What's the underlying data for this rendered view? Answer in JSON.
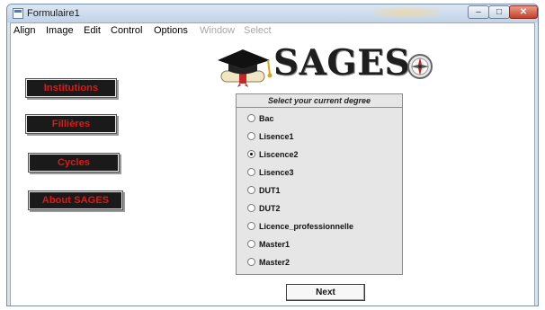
{
  "window": {
    "title": "Formulaire1",
    "controls": {
      "minimize_icon": "minimize-icon",
      "maximize_icon": "maximize-icon",
      "close_icon": "close-icon"
    }
  },
  "menu": [
    {
      "label": "Align",
      "enabled": true
    },
    {
      "label": "Image",
      "enabled": true
    },
    {
      "label": "Edit",
      "enabled": true
    },
    {
      "label": "Control",
      "enabled": true
    },
    {
      "label": "Options",
      "enabled": true
    },
    {
      "label": "Window",
      "enabled": false
    },
    {
      "label": "Select",
      "enabled": false
    }
  ],
  "logo": {
    "text": "SAGES",
    "left_icon": "graduation-cap-diploma-icon",
    "right_icon": "compass-icon"
  },
  "sidebar": {
    "colors": {
      "button_bg": "#1a1a1a",
      "button_text": "#e01818"
    },
    "buttons": [
      {
        "label": "Institutions"
      },
      {
        "label": "Fillières"
      },
      {
        "label": "Cycles"
      },
      {
        "label": "About SAGES"
      }
    ]
  },
  "degree_panel": {
    "title": "Select your current degree",
    "selected": "Liscence2",
    "options": [
      {
        "label": "Bac",
        "checked": false
      },
      {
        "label": "Lisence1",
        "checked": false
      },
      {
        "label": "Liscence2",
        "checked": true
      },
      {
        "label": "Lisence3",
        "checked": false
      },
      {
        "label": "DUT1",
        "checked": false
      },
      {
        "label": "DUT2",
        "checked": false
      },
      {
        "label": "Licence_professionnelle",
        "checked": false
      },
      {
        "label": "Master1",
        "checked": false
      },
      {
        "label": "Master2",
        "checked": false
      }
    ]
  },
  "next_button": {
    "label": "Next"
  }
}
